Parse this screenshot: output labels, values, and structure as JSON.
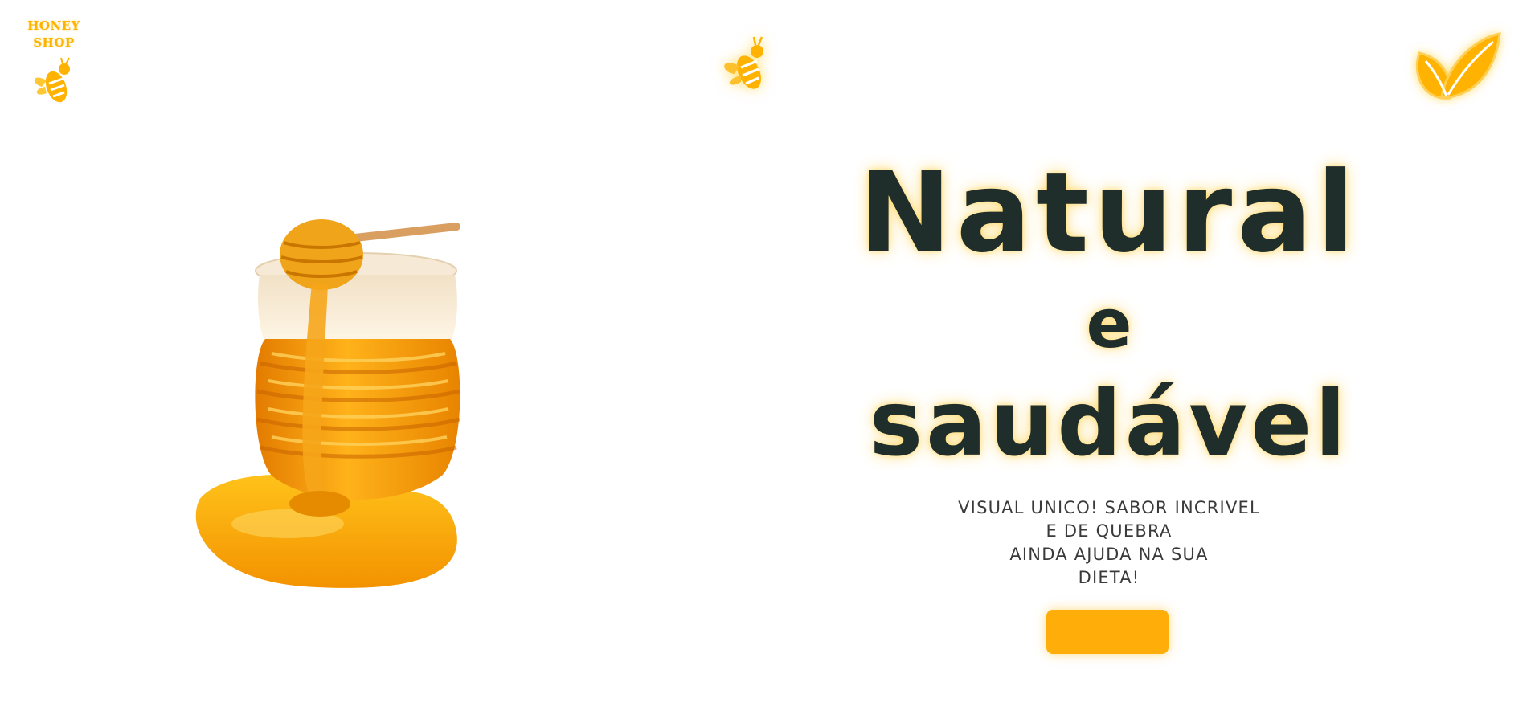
{
  "header": {
    "logo": {
      "line1": "HONEY",
      "line2": "SHOP",
      "icon": "bee-icon"
    },
    "center_icon": "bee-icon",
    "right_icon": "leaf-icon"
  },
  "hero": {
    "image": "honey-jar-with-dipper",
    "title": {
      "line1": "Natural",
      "line2": "e",
      "line3": "saudável"
    },
    "subtitle": {
      "line1": "VISUAL UNICO! SABOR INCRIVEL",
      "line2": "E DE QUEBRA",
      "line3": "AINDA AJUDA NA SUA",
      "line4": "DIETA!"
    },
    "cta_label": ""
  },
  "colors": {
    "accent": "#ffad08",
    "logo": "#ffb300",
    "title": "#1f2d2b",
    "text": "#3a3a3a",
    "divider": "#cfcfb8"
  }
}
